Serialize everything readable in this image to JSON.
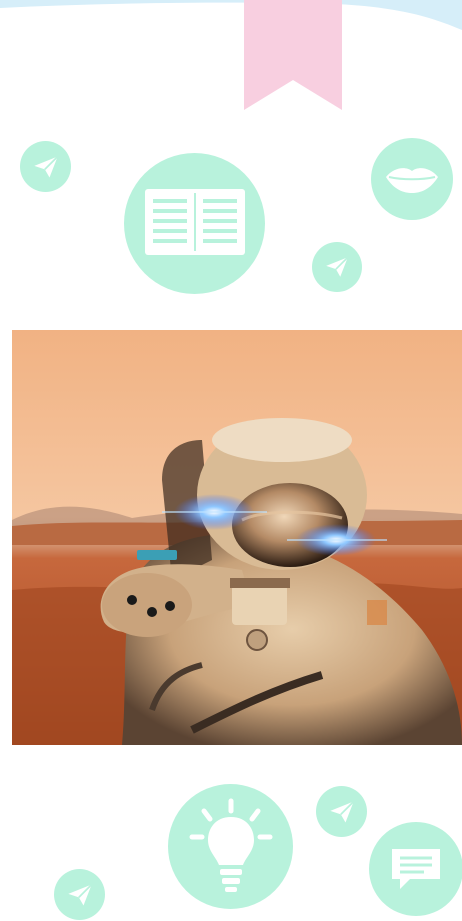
{
  "colors": {
    "mint": "#b8f2dc",
    "pink": "#f8cfe0",
    "wave": "#d6eef9",
    "white": "#ffffff"
  },
  "icons": {
    "header_bookmark": "bookmark-ribbon-icon",
    "top_left": "paper-plane-icon",
    "top_center": "book-icon",
    "top_right": "lips-icon",
    "top_small": "paper-plane-icon",
    "bottom_plane_top": "paper-plane-icon",
    "bottom_center": "lightbulb-icon",
    "bottom_right": "chat-bubble-icon",
    "bottom_left": "paper-plane-icon"
  },
  "photo": {
    "subject": "astronaut-on-mars-image"
  }
}
